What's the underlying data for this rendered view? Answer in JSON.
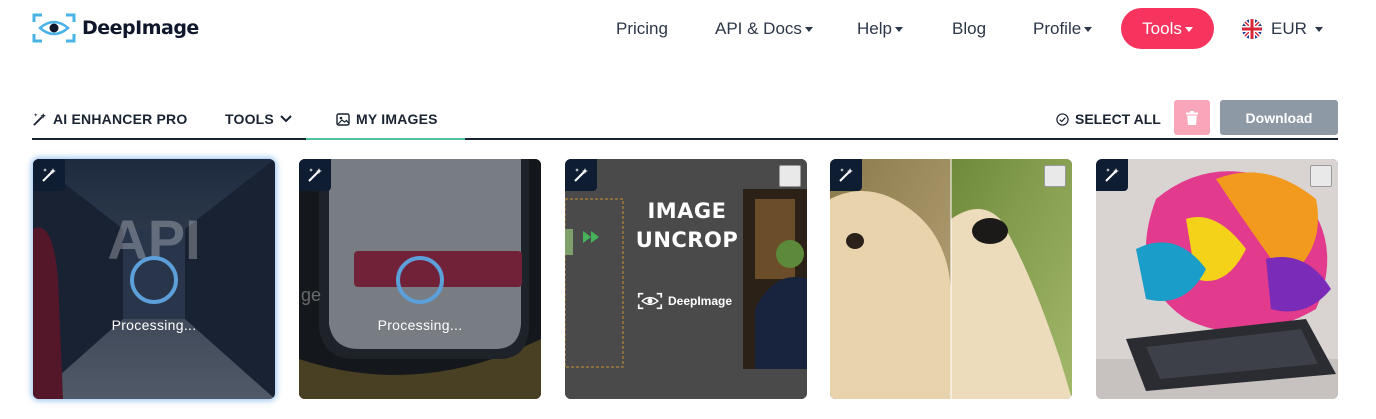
{
  "brand": {
    "name": "DeepImage",
    "accent": "#f7345e"
  },
  "nav": {
    "pricing": "Pricing",
    "api_docs": "API & Docs",
    "help": "Help",
    "blog": "Blog",
    "profile": "Profile",
    "tools": "Tools",
    "currency": "EUR"
  },
  "tabs": {
    "ai_enhancer": "AI ENHANCER PRO",
    "tools": "TOOLS",
    "my_images": "MY IMAGES",
    "active": "MY IMAGES"
  },
  "actions": {
    "select_all": "SELECT ALL",
    "download": "Download"
  },
  "images": [
    {
      "status": "Processing...",
      "background_text": "API"
    },
    {
      "status": "Processing...",
      "background_text": "ge"
    },
    {
      "title_line1": "IMAGE",
      "title_line2": "UNCROP",
      "watermark": "DeepImage"
    },
    {},
    {}
  ]
}
